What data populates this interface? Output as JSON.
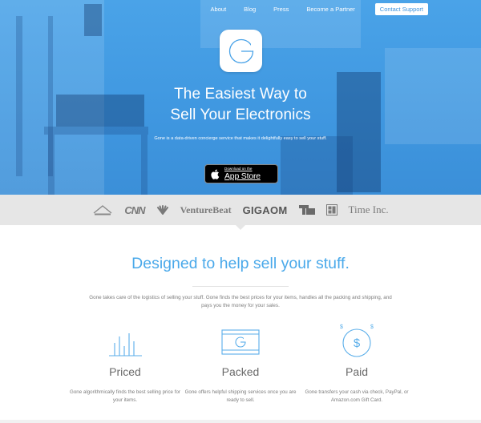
{
  "nav": {
    "links": [
      "About",
      "Blog",
      "Press",
      "Become a Partner"
    ],
    "cta": "Contact Support"
  },
  "hero": {
    "title_line1": "The Easiest Way to",
    "title_line2": "Sell Your Electronics",
    "subtitle": "Gone is a data-driven concierge service that makes it delightfully easy to sell your stuff.",
    "appstore_small": "Download on the",
    "appstore_big": "App Store"
  },
  "press": {
    "logos": [
      "CNN",
      "VentureBeat",
      "GIGAOM",
      "Time Inc."
    ]
  },
  "features": {
    "heading": "Designed to help sell your stuff.",
    "intro": "Gone takes care of the logistics of selling your stuff. Gone finds the best prices for your items, handles all the packing and shipping, and pays you the money for your sales.",
    "items": [
      {
        "title": "Priced",
        "desc": "Gone algorithmically finds the best selling price for your items."
      },
      {
        "title": "Packed",
        "desc": "Gone offers helpful shipping services once you are ready to sell."
      },
      {
        "title": "Paid",
        "desc": "Gone transfers your cash via check, PayPal, or Amazon.com Gift Card."
      }
    ]
  },
  "colors": {
    "hero_blue": "#4aa3e8",
    "accent": "#4aa9ea",
    "press_bg": "#e6e6e6"
  }
}
